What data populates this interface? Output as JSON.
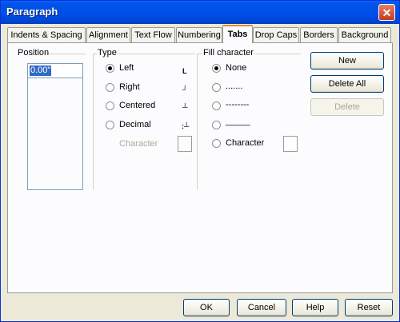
{
  "window": {
    "title": "Paragraph",
    "close_glyph": "✕"
  },
  "tabs": [
    {
      "label": "Indents & Spacing"
    },
    {
      "label": "Alignment"
    },
    {
      "label": "Text Flow"
    },
    {
      "label": "Numbering"
    },
    {
      "label": "Tabs",
      "active": true
    },
    {
      "label": "Drop Caps"
    },
    {
      "label": "Borders"
    },
    {
      "label": "Background"
    }
  ],
  "position": {
    "label": "Position",
    "value": "0.00\""
  },
  "type": {
    "label": "Type",
    "options": [
      {
        "label": "Left",
        "checked": true
      },
      {
        "label": "Right",
        "checked": false
      },
      {
        "label": "Centered",
        "checked": false
      },
      {
        "label": "Decimal",
        "checked": false
      }
    ],
    "character_label": "Character"
  },
  "fill": {
    "label": "Fill character",
    "options": [
      {
        "label": "None",
        "checked": true
      },
      {
        "label": ".......",
        "checked": false
      },
      {
        "label": "--------",
        "checked": false
      },
      {
        "label": "_____",
        "checked": false
      },
      {
        "label": "Character",
        "checked": false
      }
    ]
  },
  "side_buttons": {
    "new": "New",
    "delete_all": "Delete All",
    "delete": "Delete"
  },
  "footer": {
    "ok": "OK",
    "cancel": "Cancel",
    "help": "Help",
    "reset": "Reset"
  },
  "icons": {
    "close": "close-icon",
    "tab_left": "tab-left-icon",
    "tab_right": "tab-right-icon",
    "tab_center": "tab-center-icon",
    "tab_decimal": "tab-decimal-icon"
  }
}
